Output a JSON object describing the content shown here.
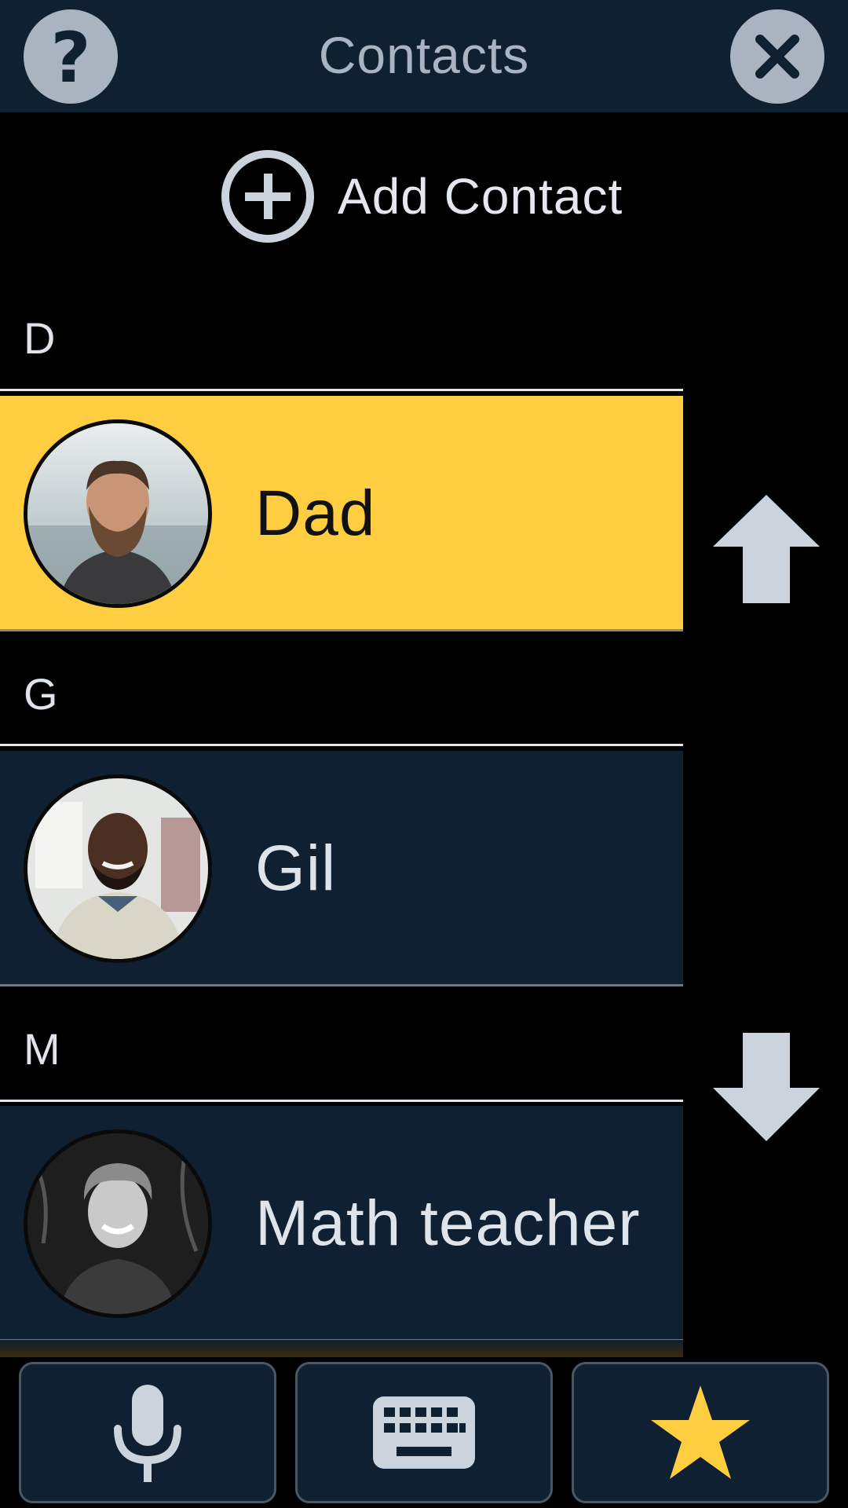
{
  "header": {
    "title": "Contacts",
    "help_icon": "question-mark",
    "help_glyph": "?",
    "close_icon": "close-x"
  },
  "add_contact": {
    "label": "Add Contact",
    "icon": "plus-circle"
  },
  "sections": [
    {
      "letter": "D",
      "contacts": [
        {
          "name": "Dad",
          "selected": true,
          "avatar": "bearded man in dark sweater, beach background"
        }
      ]
    },
    {
      "letter": "G",
      "contacts": [
        {
          "name": "Gil",
          "selected": false,
          "avatar": "smiling man in light sweater, office background"
        }
      ]
    },
    {
      "letter": "M",
      "contacts": [
        {
          "name": "Math teacher",
          "selected": false,
          "avatar": "black-and-white photo of smiling curly-haired man"
        }
      ]
    }
  ],
  "scroll": {
    "up_icon": "arrow-up",
    "down_icon": "arrow-down"
  },
  "toolbar": {
    "buttons": [
      {
        "icon": "microphone"
      },
      {
        "icon": "keyboard"
      },
      {
        "icon": "star"
      }
    ]
  },
  "colors": {
    "header_bg": "#0f2031",
    "row_bg": "#0e2031",
    "selected_row": "#ffcd40",
    "star": "#ffcd40",
    "icon_light": "#cbd3dd"
  }
}
